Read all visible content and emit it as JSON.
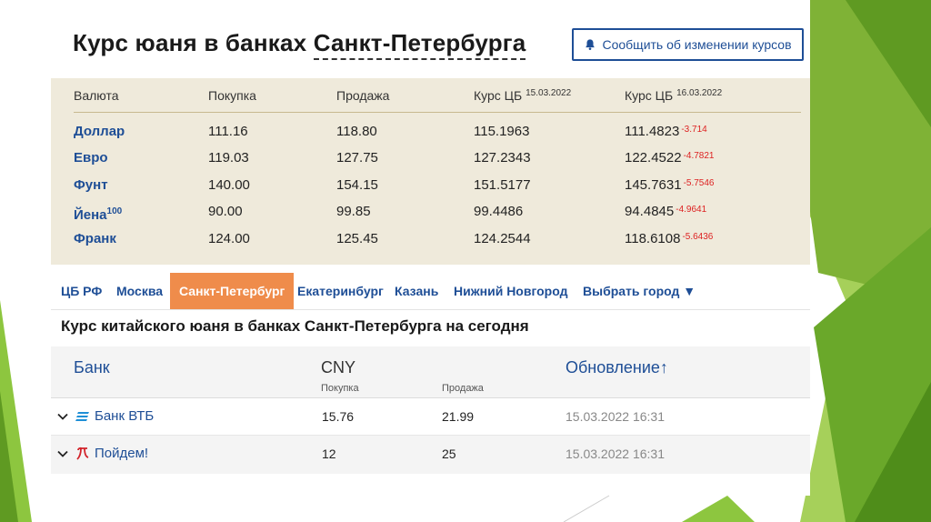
{
  "header": {
    "title_prefix": "Курс юаня в банках",
    "title_city": "Санкт-Петербурга",
    "report_button": "Сообщить об изменении курсов",
    "report_icon": "bell-icon"
  },
  "rates": {
    "columns": {
      "currency": "Валюта",
      "buy": "Покупка",
      "sell": "Продажа",
      "cb_today": "Курс ЦБ",
      "cb_today_date": "15.03.2022",
      "cb_tomorrow": "Курс ЦБ",
      "cb_tomorrow_date": "16.03.2022"
    },
    "rows": [
      {
        "name": "Доллар",
        "sup": "",
        "buy": "111.16",
        "sell": "118.80",
        "cb": "115.1963",
        "cb_next": "111.4823",
        "delta": "-3.714"
      },
      {
        "name": "Евро",
        "sup": "",
        "buy": "119.03",
        "sell": "127.75",
        "cb": "127.2343",
        "cb_next": "122.4522",
        "delta": "-4.7821"
      },
      {
        "name": "Фунт",
        "sup": "",
        "buy": "140.00",
        "sell": "154.15",
        "cb": "151.5177",
        "cb_next": "145.7631",
        "delta": "-5.7546"
      },
      {
        "name": "Йена",
        "sup": "100",
        "buy": "90.00",
        "sell": "99.85",
        "cb": "99.4486",
        "cb_next": "94.4845",
        "delta": "-4.9641"
      },
      {
        "name": "Франк",
        "sup": "",
        "buy": "124.00",
        "sell": "125.45",
        "cb": "124.2544",
        "cb_next": "118.6108",
        "delta": "-5.6436"
      }
    ]
  },
  "tabs": [
    {
      "label": "ЦБ РФ",
      "active": false
    },
    {
      "label": "Москва",
      "active": false
    },
    {
      "label": "Санкт-Петербург",
      "active": true
    },
    {
      "label": "Екатеринбург",
      "active": false
    },
    {
      "label": "Казань",
      "active": false
    },
    {
      "label": "Нижний Новгород",
      "active": false
    },
    {
      "label": "Выбрать город ▼",
      "active": false
    }
  ],
  "section_title": "Курс китайского юаня в банках Санкт-Петербурга на сегодня",
  "bank_table": {
    "col_bank": "Банк",
    "col_currency": "CNY",
    "col_buy": "Покупка",
    "col_sell": "Продажа",
    "col_update": "Обновление↑",
    "rows": [
      {
        "name": "Банк ВТБ",
        "logo": "vtb-logo-icon",
        "buy": "15.76",
        "sell": "21.99",
        "updated": "15.03.2022 16:31"
      },
      {
        "name": "Пойдем!",
        "logo": "poidem-logo-icon",
        "buy": "12",
        "sell": "25",
        "updated": "15.03.2022 16:31"
      }
    ]
  },
  "colors": {
    "accent_blue": "#1e4e96",
    "active_tab": "#ef8c4b",
    "panel_beige": "#efeadb",
    "delta_red": "#dd2222",
    "slide_green": "#8dc63f"
  }
}
